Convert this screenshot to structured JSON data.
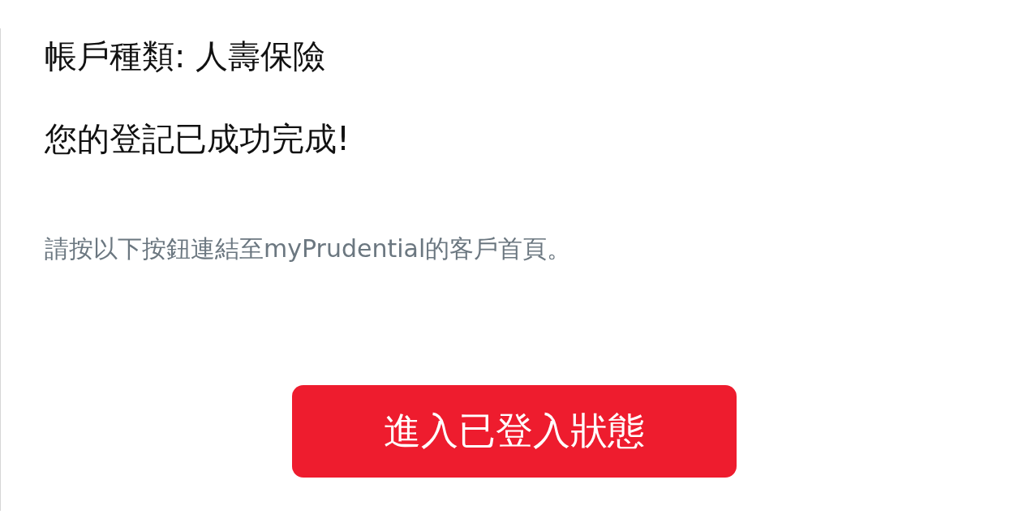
{
  "account_type": "帳戶種類: 人壽保險",
  "success_message": "您的登記已成功完成!",
  "instruction": "請按以下按鈕連結至myPrudential的客戶首頁。",
  "button": {
    "label": "進入已登入狀態"
  }
}
